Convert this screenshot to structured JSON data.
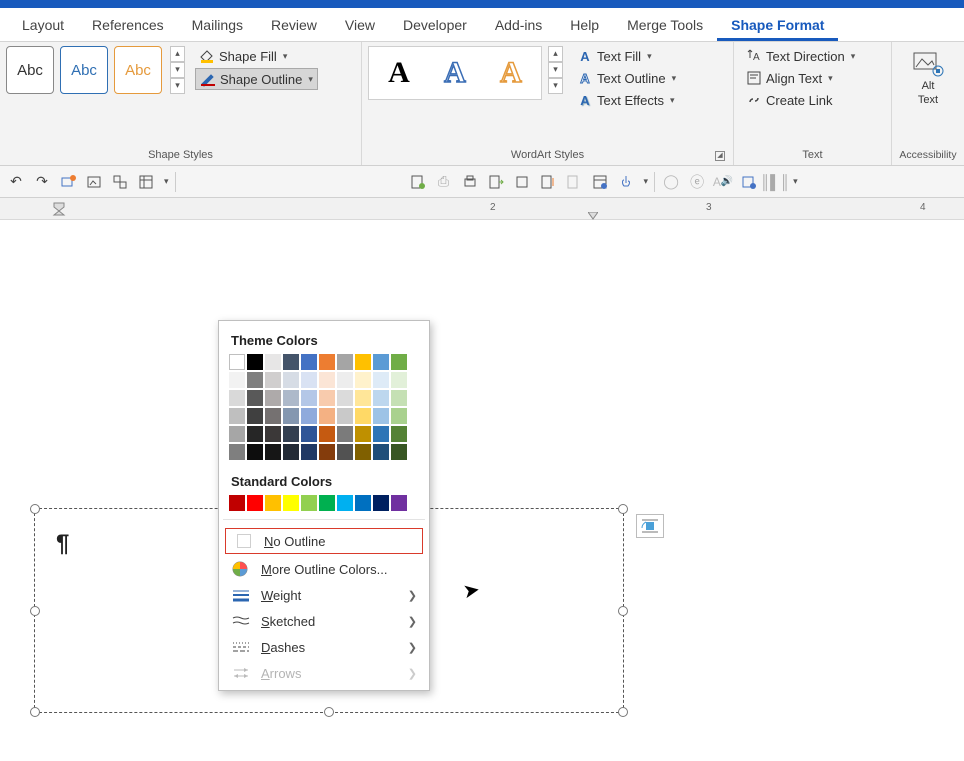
{
  "tabs": {
    "items": [
      "Layout",
      "References",
      "Mailings",
      "Review",
      "View",
      "Developer",
      "Add-ins",
      "Help",
      "Merge Tools",
      "Shape Format"
    ],
    "active": "Shape Format"
  },
  "ribbon": {
    "shape_styles": {
      "label": "Shape Styles",
      "swatches": [
        "Abc",
        "Abc",
        "Abc"
      ],
      "swatch_colors": [
        "#333333",
        "#2f6fb3",
        "#e59a3c"
      ],
      "shape_fill": "Shape Fill",
      "shape_outline": "Shape Outline"
    },
    "wordart": {
      "label": "WordArt Styles",
      "text_fill": "Text Fill",
      "text_outline": "Text Outline",
      "text_effects": "Text Effects"
    },
    "text": {
      "label": "Text",
      "direction": "Text Direction",
      "align": "Align Text",
      "create_link": "Create Link"
    },
    "accessibility": {
      "label": "Accessibility",
      "alt_text_line1": "Alt",
      "alt_text_line2": "Text"
    }
  },
  "dropdown": {
    "theme_title": "Theme Colors",
    "standard_title": "Standard Colors",
    "theme_row": [
      "#ffffff",
      "#000000",
      "#e7e6e6",
      "#44546a",
      "#4472c4",
      "#ed7d31",
      "#a5a5a5",
      "#ffc000",
      "#5b9bd5",
      "#70ad47"
    ],
    "theme_shades": [
      [
        "#f2f2f2",
        "#d9d9d9",
        "#bfbfbf",
        "#a6a6a6",
        "#7f7f7f"
      ],
      [
        "#7f7f7f",
        "#595959",
        "#404040",
        "#262626",
        "#0d0d0d"
      ],
      [
        "#d0cece",
        "#aeaaaa",
        "#757171",
        "#3b3838",
        "#161616"
      ],
      [
        "#d6dce5",
        "#adb9ca",
        "#8497b0",
        "#333f50",
        "#222a35"
      ],
      [
        "#d9e2f3",
        "#b4c7e7",
        "#8faadc",
        "#2f5597",
        "#203864"
      ],
      [
        "#fbe5d6",
        "#f8cbad",
        "#f4b183",
        "#c55a11",
        "#843c0c"
      ],
      [
        "#ededed",
        "#dbdbdb",
        "#c9c9c9",
        "#7b7b7b",
        "#525252"
      ],
      [
        "#fff2cc",
        "#ffe699",
        "#ffd966",
        "#bf9000",
        "#806000"
      ],
      [
        "#deebf7",
        "#bdd7ee",
        "#9dc3e6",
        "#2e75b6",
        "#1f4e79"
      ],
      [
        "#e2f0d9",
        "#c5e0b4",
        "#a9d18e",
        "#548235",
        "#385723"
      ]
    ],
    "standard_row": [
      "#c00000",
      "#ff0000",
      "#ffc000",
      "#ffff00",
      "#92d050",
      "#00b050",
      "#00b0f0",
      "#0070c0",
      "#002060",
      "#7030a0"
    ],
    "no_outline": "No Outline",
    "more_colors": "More Outline Colors...",
    "weight": "Weight",
    "sketched": "Sketched",
    "dashes": "Dashes",
    "arrows": "Arrows"
  },
  "ruler": {
    "n2": "2",
    "n3": "3",
    "n4": "4"
  },
  "shape_content": "¶"
}
